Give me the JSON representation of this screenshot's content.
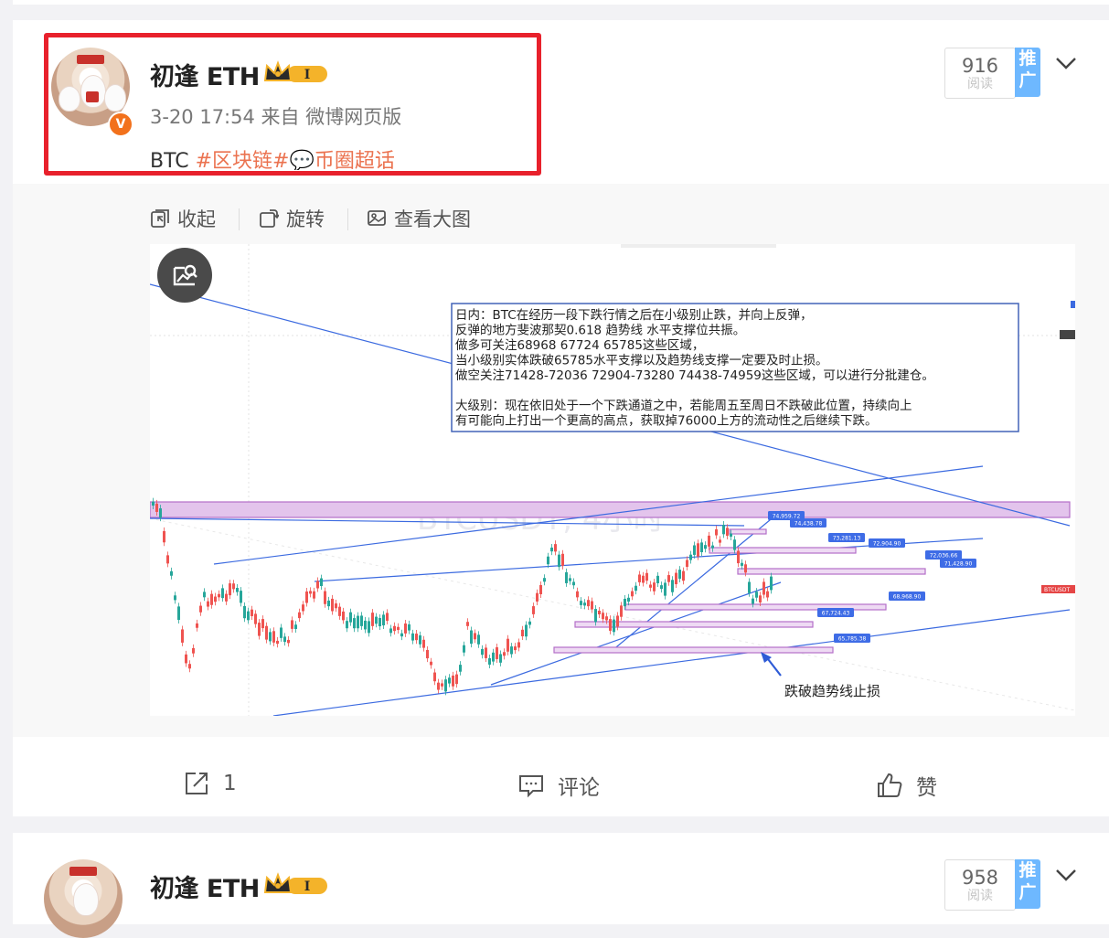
{
  "post": {
    "author": "初逢 ETH",
    "level_badge": "I",
    "time": "3-20 17:54",
    "source": "来自 微博网页版",
    "content_prefix": "BTC",
    "content_tags": "#区块链#💬币圈超话",
    "reads_count": "916",
    "reads_label": "阅读",
    "promote_label": "推广",
    "toolbar": {
      "collapse": "收起",
      "rotate": "旋转",
      "view_large": "查看大图"
    },
    "actions": {
      "repost_count": "1",
      "comment": "评论",
      "like": "赞"
    }
  },
  "chart": {
    "watermark": "BTCUSDT, 4小时",
    "annotation_lines": [
      "日内：BTC在经历一段下跌行情之后在小级别止跌，并向上反弹，",
      "反弹的地方斐波那契0.618  趋势线  水平支撑位共振。",
      "做多可关注68968  67724  65785这些区域，",
      "当小级别实体跌破65785水平支撑以及趋势线支撑一定要及时止损。",
      "做空关注71428-72036  72904-73280  74438-74959这些区域，可以进行分批建仓。",
      "",
      "大级别：现在依旧处于一个下跌通道之中，若能周五至周日不跌破此位置，持续向上",
      "有可能向上打出一个更高的高点，获取掉76000上方的流动性之后继续下跌。"
    ],
    "price_tags": [
      "74,959.72",
      "74,438.78",
      "73,281.13",
      "72,904.90",
      "72,036.66",
      "71,428.90",
      "68,968.90",
      "67,724.43",
      "65,785.38"
    ],
    "stop_note": "跌破趋势线止损",
    "right_tag": "BTCUSDT"
  },
  "next_post": {
    "author": "初逢 ETH",
    "level_badge": "I",
    "reads_count": "958",
    "reads_label": "阅读",
    "promote_label": "推广"
  },
  "colors": {
    "accent": "#eb7350",
    "highlight_box": "#e8212c",
    "promote": "#6eb8ff",
    "zone": "#c98fd6",
    "trend": "#3b6ae0"
  }
}
